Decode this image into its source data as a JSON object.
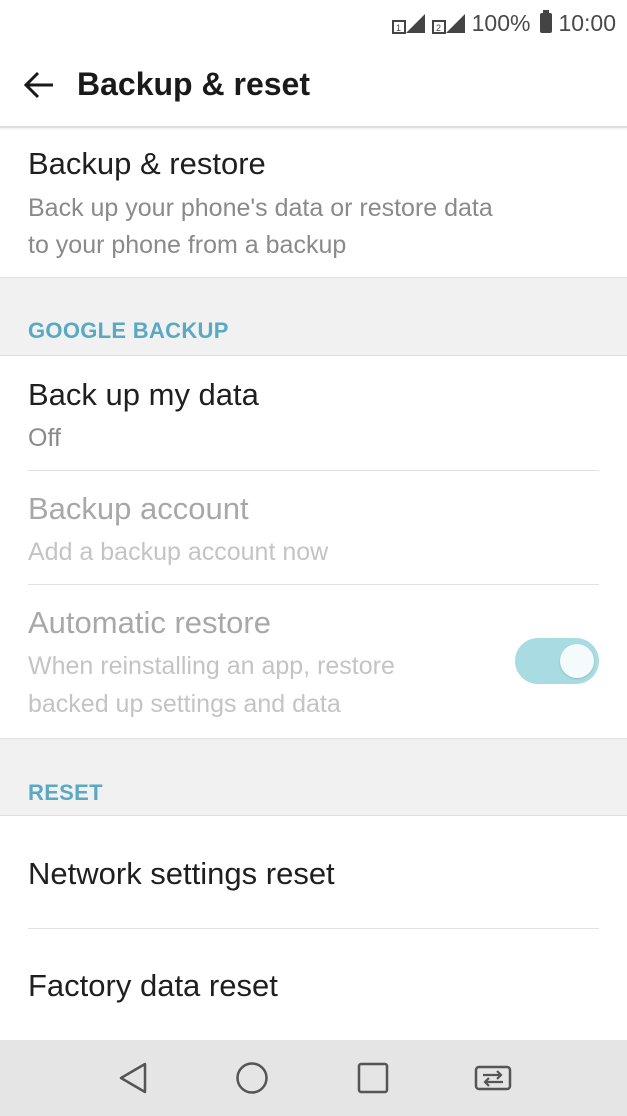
{
  "status": {
    "battery": "100%",
    "time": "10:00"
  },
  "header": {
    "title": "Backup & reset"
  },
  "backup_restore": {
    "title": "Backup & restore",
    "subtitle_line1": "Back up your phone's data or restore data",
    "subtitle_line2": "to your phone from a backup"
  },
  "google_backup": {
    "header": "GOOGLE BACKUP",
    "back_up_my_data": {
      "title": "Back up my data",
      "value": "Off"
    },
    "backup_account": {
      "title": "Backup account",
      "subtitle": "Add a backup account now"
    },
    "automatic_restore": {
      "title": "Automatic restore",
      "subtitle_line1": "When reinstalling an app, restore",
      "subtitle_line2": "backed up settings and data",
      "toggle_on": true
    }
  },
  "reset": {
    "header": "RESET",
    "network": "Network settings reset",
    "factory": "Factory data reset"
  },
  "colors": {
    "accent": "#5aa9c3",
    "toggle_track": "#a9dbe3",
    "section_bg": "#f1f1f1",
    "nav_bg": "#e5e5e5"
  },
  "nav": {
    "icons": [
      "back-triangle-icon",
      "home-circle-icon",
      "recents-square-icon",
      "dual-window-icon"
    ]
  }
}
